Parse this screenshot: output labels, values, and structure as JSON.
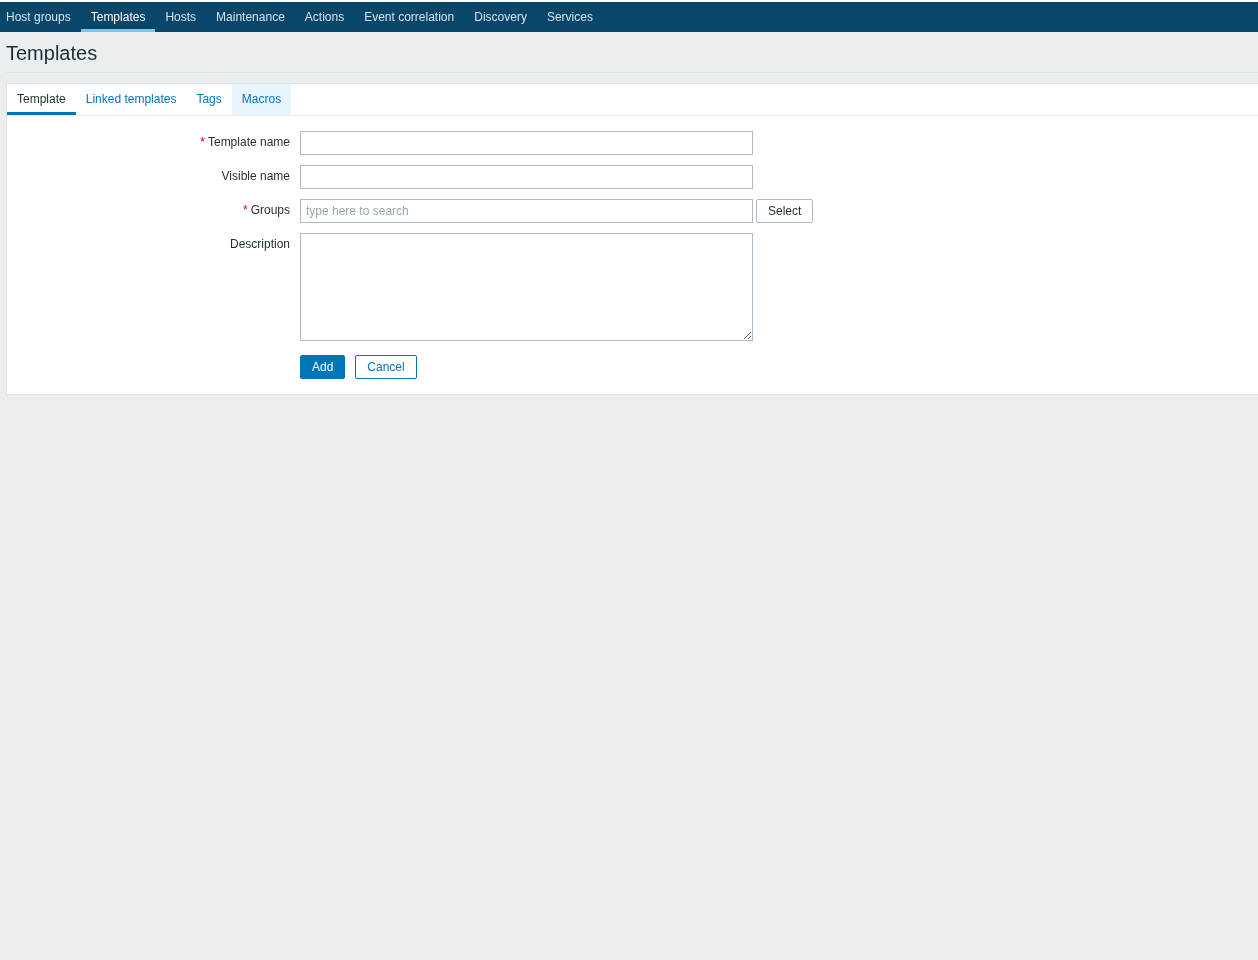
{
  "top_nav": [
    {
      "label": "Host groups",
      "selected": false
    },
    {
      "label": "Templates",
      "selected": true
    },
    {
      "label": "Hosts",
      "selected": false
    },
    {
      "label": "Maintenance",
      "selected": false
    },
    {
      "label": "Actions",
      "selected": false
    },
    {
      "label": "Event correlation",
      "selected": false
    },
    {
      "label": "Discovery",
      "selected": false
    },
    {
      "label": "Services",
      "selected": false
    }
  ],
  "page_title": "Templates",
  "tabs": [
    {
      "label": "Template",
      "selected": true,
      "hovered": false
    },
    {
      "label": "Linked templates",
      "selected": false,
      "hovered": false
    },
    {
      "label": "Tags",
      "selected": false,
      "hovered": false
    },
    {
      "label": "Macros",
      "selected": false,
      "hovered": true
    }
  ],
  "form": {
    "fields": [
      {
        "kind": "text",
        "label": "Template name",
        "required_mark": "*"
      },
      {
        "kind": "text",
        "label": "Visible name"
      },
      {
        "kind": "multiselect",
        "label": "Groups",
        "required_mark": "*",
        "placeholder": "type here to search",
        "button": "Select"
      },
      {
        "kind": "textarea",
        "label": "Description"
      }
    ],
    "buttons": [
      {
        "label": "Add",
        "kind": "primary"
      },
      {
        "label": "Cancel",
        "kind": "secondary"
      }
    ]
  }
}
